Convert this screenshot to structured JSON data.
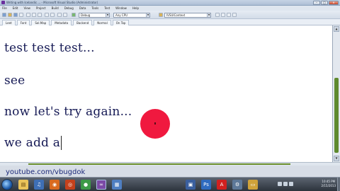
{
  "window": {
    "title": "Writing with Icelandic ... - Microsoft Visual Studio (Administrator)",
    "buttons": {
      "minimize": "–",
      "maximize": "□",
      "close": "✕"
    }
  },
  "menu": [
    "File",
    "Edit",
    "View",
    "Project",
    "Build",
    "Debug",
    "Data",
    "Tools",
    "Test",
    "Window",
    "Help"
  ],
  "toolbar": {
    "config_value": "Debug",
    "platform_value": "Any CPU",
    "find_value": "IVSUIContext"
  },
  "tabs": [
    "Leet",
    "Font",
    "Sol.Map",
    "Metadata",
    "Backend",
    "Normal",
    "On Top"
  ],
  "document": {
    "lines": [
      "test test test...",
      "see",
      "now let's try again...",
      "we add a"
    ]
  },
  "scrollbar": {
    "up": "▲",
    "down": "▼"
  },
  "watermark": "youtube.com/vbugdok",
  "taskbar": {
    "icons": [
      "explorer-icon",
      "media-icon",
      "firefox-icon",
      "chrome-icon",
      "visual-studio-icon",
      "document-icon",
      "photoshop-icon",
      "acrobat-icon",
      "misc-icon"
    ],
    "clock_time": "10:45 PM",
    "clock_date": "2/15/2013"
  }
}
